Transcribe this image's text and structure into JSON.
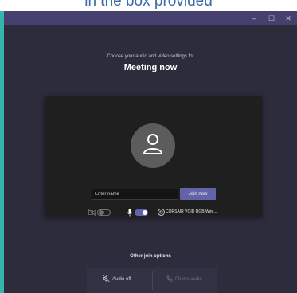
{
  "banner": {
    "text": "in the box provided"
  },
  "window": {
    "controls": {
      "minimize": "–",
      "maximize": "☐",
      "close": "✕"
    }
  },
  "header": {
    "subtitle": "Choose your audio and video settings for",
    "title": "Meeting now"
  },
  "prejoin": {
    "name_placeholder": "Enter name",
    "join_label": "Join now",
    "video_on": false,
    "mic_on": true,
    "audio_device": "CORSAIR VOID RGB Wire..."
  },
  "other_options": {
    "title": "Other join options",
    "audio_off_label": "Audio off",
    "phone_audio_label": "Phone audio"
  },
  "colors": {
    "accent": "#6264a7",
    "titlebar": "#46406e",
    "background": "#2d2c3c",
    "preview": "#1f1f1f"
  },
  "icons": [
    "camera-off-icon",
    "microphone-icon",
    "speaker-icon",
    "speaker-off-icon",
    "phone-icon",
    "person-icon"
  ]
}
